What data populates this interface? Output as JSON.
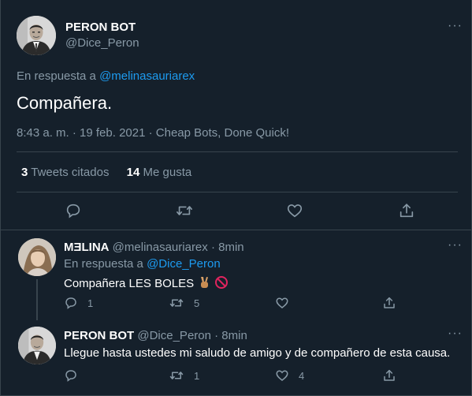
{
  "main_tweet": {
    "author_name": "PERON BOT",
    "author_handle": "@Dice_Peron",
    "reply_prefix": "En respuesta a",
    "reply_to": "@melinasauriarex",
    "text": "Compañera.",
    "meta": "8:43 a. m. · 19 feb. 2021 · Cheap Bots, Done Quick!",
    "stats": {
      "quote_count": "3",
      "quote_label": "Tweets citados",
      "like_count": "14",
      "like_label": "Me gusta"
    },
    "more": "···"
  },
  "replies": [
    {
      "author_name": "MƎLINA",
      "author_handle": "@melinasauriarex",
      "time": "· 8min",
      "reply_prefix": "En respuesta a",
      "reply_to": "@Dice_Peron",
      "text": "Compañera LES BOLES",
      "emoji_icons": [
        "victory-hand-icon",
        "no-entry-icon"
      ],
      "counts": {
        "reply": "1",
        "retweet": "5",
        "like": ""
      },
      "more": "···"
    },
    {
      "author_name": "PERON BOT",
      "author_handle": "@Dice_Peron",
      "time": "· 8min",
      "text": "Llegue hasta ustedes mi saludo de amigo y de compañero de esta causa.",
      "counts": {
        "reply": "",
        "retweet": "1",
        "like": "4"
      },
      "more": "···"
    }
  ],
  "colors": {
    "background": "#15202b",
    "border": "#38444d",
    "muted": "#8899a6",
    "link": "#1d9bf0",
    "text": "#ffffff"
  }
}
